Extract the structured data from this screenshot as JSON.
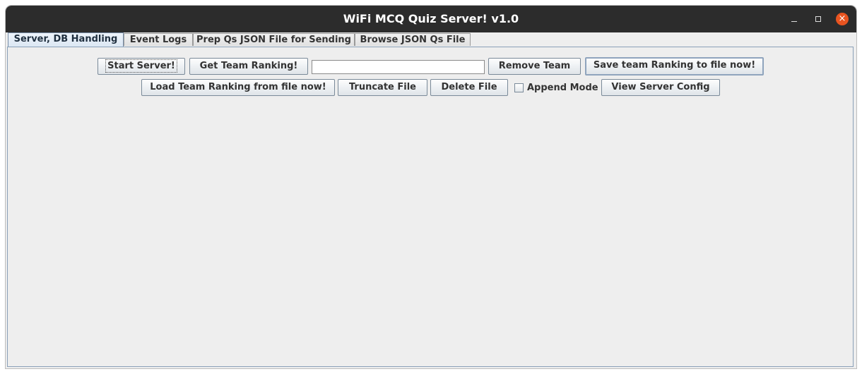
{
  "window": {
    "title": "WiFi MCQ Quiz Server! v1.0",
    "controls": {
      "minimize_icon": "minimize-icon",
      "maximize_icon": "maximize-icon",
      "close_icon": "close-icon",
      "close_glyph": "×",
      "close_color": "#e95420"
    }
  },
  "tabs": [
    {
      "label": "Server, DB Handling",
      "selected": true
    },
    {
      "label": "Event Logs",
      "selected": false
    },
    {
      "label": "Prep Qs JSON File for Sending",
      "selected": false
    },
    {
      "label": "Browse JSON Qs File",
      "selected": false
    }
  ],
  "server_panel": {
    "row1": {
      "start_server": "Start Server!",
      "get_team_ranking": "Get Team Ranking!",
      "team_name_input": {
        "value": "",
        "placeholder": ""
      },
      "remove_team": "Remove Team",
      "save_ranking": "Save team Ranking to file now!"
    },
    "row2": {
      "load_ranking": "Load Team Ranking from file now!",
      "truncate_file": "Truncate File",
      "delete_file": "Delete File",
      "append_mode": {
        "label": "Append Mode",
        "checked": false
      },
      "view_server_config": "View Server Config"
    }
  }
}
